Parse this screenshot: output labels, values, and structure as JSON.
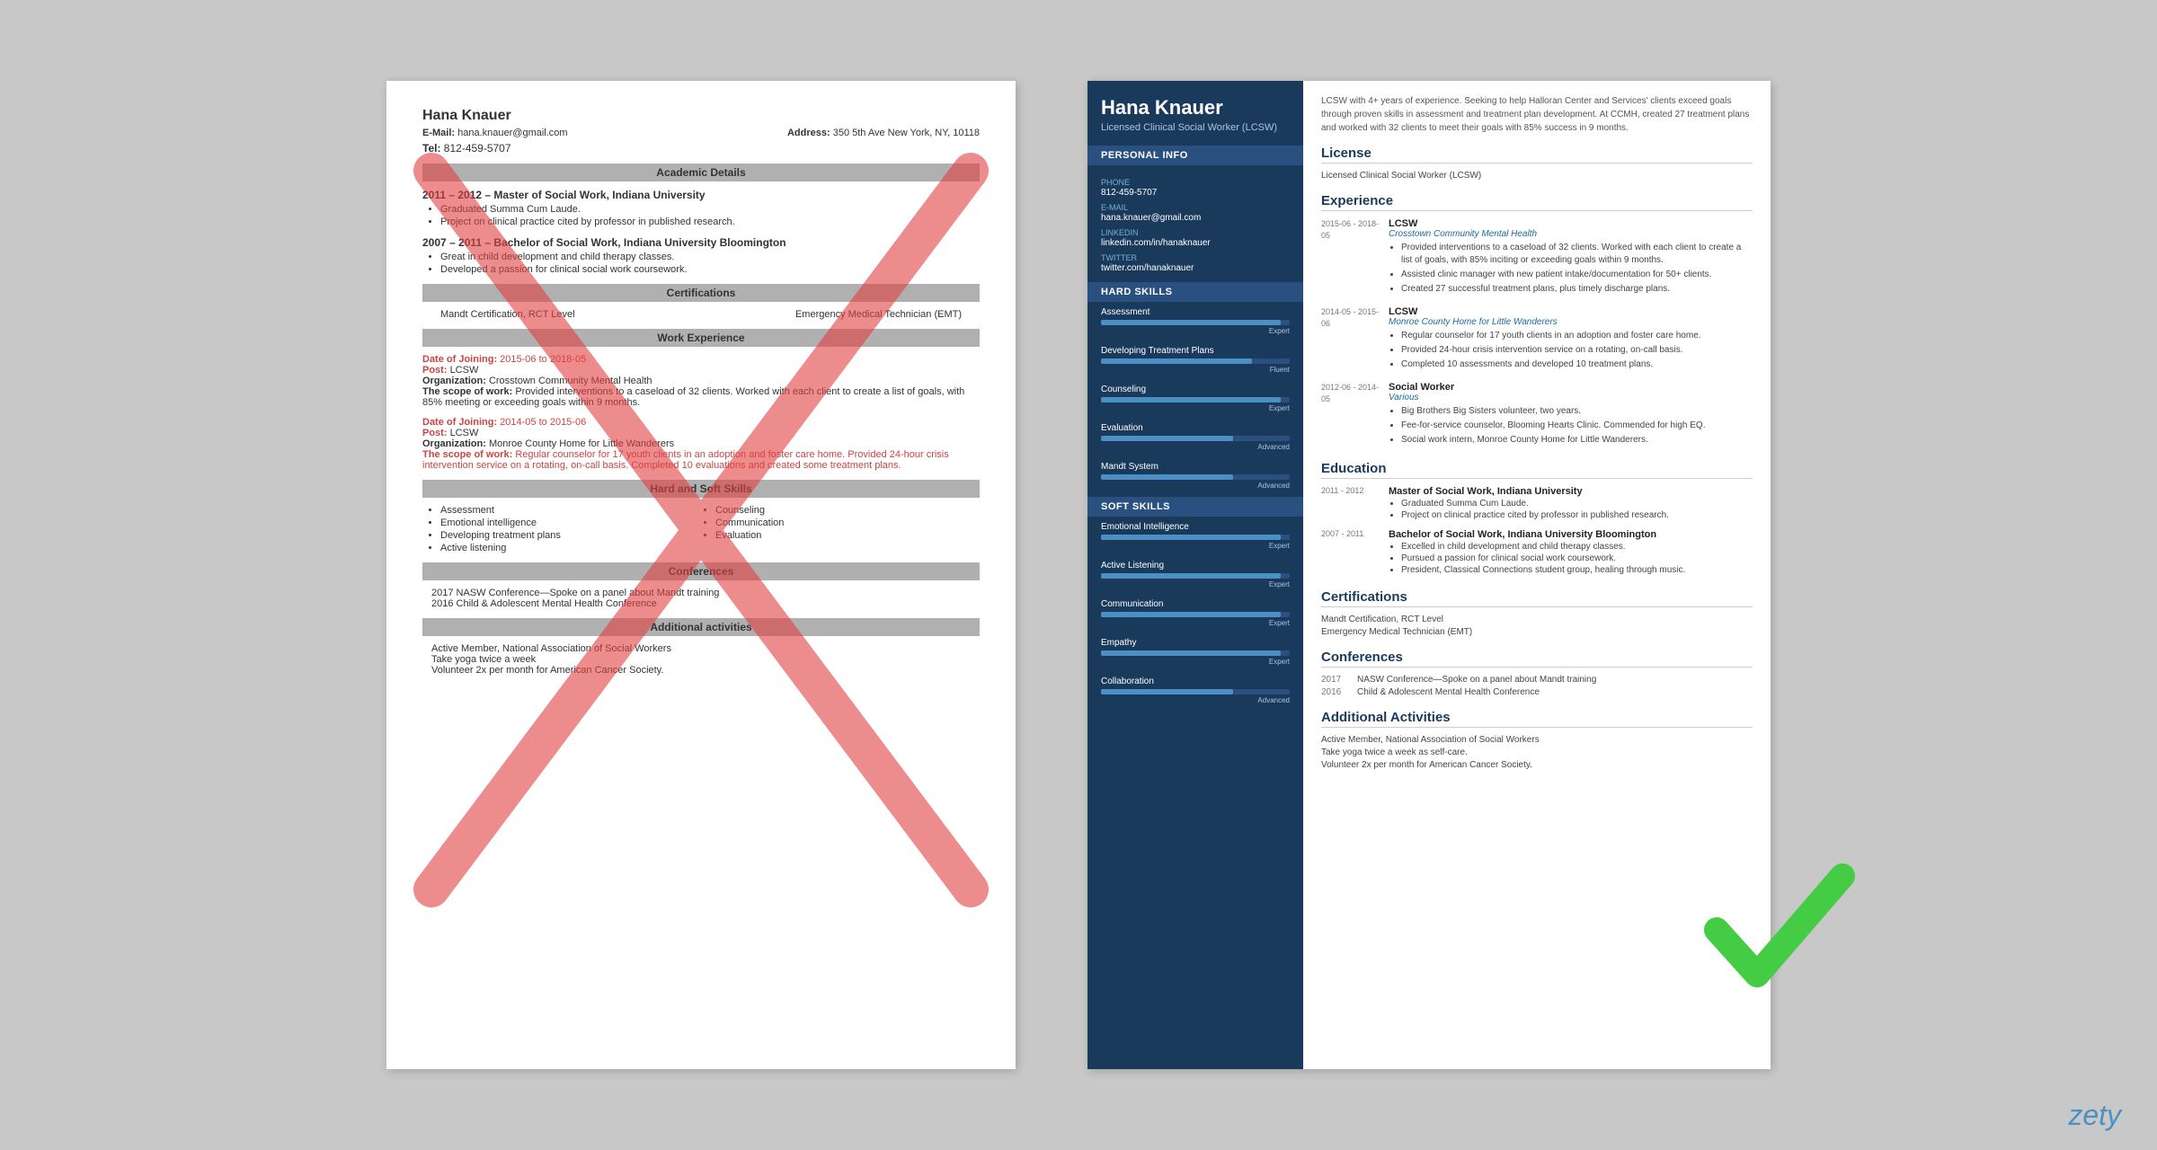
{
  "page": {
    "background": "#c8c8c8",
    "logo": "zety"
  },
  "bad_resume": {
    "name": "Hana Knauer",
    "email_label": "E-Mail:",
    "email": "hana.knauer@gmail.com",
    "address_label": "Address:",
    "address": "350 5th Ave New York, NY, 10118",
    "tel_label": "Tel:",
    "tel": "812-459-5707",
    "sections": {
      "academic": "Academic Details",
      "certs": "Certifications",
      "work": "Work Experience",
      "skills": "Hard and Soft Skills",
      "conferences": "Conferences",
      "activities": "Additional activities"
    },
    "edu": [
      {
        "years": "2011 – 2012 –",
        "degree": "Master of Social Work, Indiana University",
        "bullets": [
          "Graduated Summa Cum Laude.",
          "Project on clinical practice cited by professor in published research."
        ]
      },
      {
        "years": "2007 – 2011 –",
        "degree": "Bachelor of Social Work, Indiana University Bloomington",
        "bullets": [
          "Great in child development and child therapy classes.",
          "Developed a passion for clinical social work coursework."
        ]
      }
    ],
    "certs": [
      "Mandt Certification, RCT Level",
      "Emergency Medical Technician (EMT)"
    ],
    "work": [
      {
        "date_label": "Date of Joining:",
        "date": "2015-06 to 2018-05",
        "post_label": "Post:",
        "post": "LCSW",
        "org_label": "Organization:",
        "org": "Crosstown Community Mental Health",
        "scope_label": "The scope of work:",
        "scope": "Provided interventions to a caseload of 32 clients. Worked with each client to create a list of goals, with 85% meeting or exceeding goals within 9 months."
      },
      {
        "date_label": "Date of Joining:",
        "date": "2014-05 to 2015-06",
        "post_label": "Post:",
        "post": "LCSW",
        "org_label": "Organization:",
        "org": "Monroe County Home for Little Wanderers",
        "scope_label": "The scope of work:",
        "scope": "Regular counselor for 17 youth clients in an adoption and foster care home. Provided 24-hour crisis intervention service on a rotating, on-call basis. Completed 10 evaluations and created some treatment plans."
      }
    ],
    "skills": [
      "Assessment",
      "Emotional intelligence",
      "Developing treatment plans",
      "Active listening",
      "Counseling",
      "Communication",
      "Evaluation"
    ],
    "conferences": [
      "2017 NASW Conference—Spoke on a panel about Mandt training",
      "2016 Child & Adolescent Mental Health Conference"
    ],
    "activities": [
      "Active Member, National Association of Social Workers",
      "Take yoga twice a week",
      "Volunteer 2x per month for American Cancer Society."
    ]
  },
  "good_resume": {
    "name": "Hana Knauer",
    "title": "Licensed Clinical Social Worker (LCSW)",
    "summary": "LCSW with 4+ years of experience. Seeking to help Halloran Center and Services' clients exceed goals through proven skills in assessment and treatment plan development. At CCMH, created 27 treatment plans and worked with 32 clients to meet their goals with 85% success in 9 months.",
    "personal_info_title": "Personal Info",
    "phone_label": "Phone",
    "phone": "812-459-5707",
    "email_label": "E-mail",
    "email": "hana.knauer@gmail.com",
    "linkedin_label": "LinkedIn",
    "linkedin": "linkedin.com/in/hanaknauer",
    "twitter_label": "Twitter",
    "twitter": "twitter.com/hanaknauer",
    "hard_skills_title": "Hard Skills",
    "skills_hard": [
      {
        "name": "Assessment",
        "level": "Expert",
        "pct": 95
      },
      {
        "name": "Developing Treatment Plans",
        "level": "Fluent",
        "pct": 80
      },
      {
        "name": "Counseling",
        "level": "Expert",
        "pct": 95
      },
      {
        "name": "Evaluation",
        "level": "Advanced",
        "pct": 70
      },
      {
        "name": "Mandt System",
        "level": "Advanced",
        "pct": 70
      }
    ],
    "soft_skills_title": "Soft Skills",
    "skills_soft": [
      {
        "name": "Emotional Intelligence",
        "level": "Expert",
        "pct": 95
      },
      {
        "name": "Active Listening",
        "level": "Expert",
        "pct": 95
      },
      {
        "name": "Communication",
        "level": "Expert",
        "pct": 95
      },
      {
        "name": "Empathy",
        "level": "Expert",
        "pct": 95
      },
      {
        "name": "Collaboration",
        "level": "Advanced",
        "pct": 70
      }
    ],
    "license_title": "License",
    "license": "Licensed Clinical Social Worker (LCSW)",
    "experience_title": "Experience",
    "experience": [
      {
        "date": "2015-06 - 2018-05",
        "title": "LCSW",
        "employer": "Crosstown Community Mental Health",
        "bullets": [
          "Provided interventions to a caseload of 32 clients. Worked with each client to create a list of goals, with 85% inciting or exceeding goals within 9 months.",
          "Assisted clinic manager with new patient intake/documentation for 50+ clients.",
          "Created 27 successful treatment plans, plus timely discharge plans."
        ]
      },
      {
        "date": "2014-05 - 2015-06",
        "title": "LCSW",
        "employer": "Monroe County Home for Little Wanderers",
        "bullets": [
          "Regular counselor for 17 youth clients in an adoption and foster care home.",
          "Provided 24-hour crisis intervention service on a rotating, on-call basis.",
          "Completed 10 assessments and developed 10 treatment plans."
        ]
      },
      {
        "date": "2012-06 - 2014-05",
        "title": "Social Worker",
        "employer": "Various",
        "bullets": [
          "Big Brothers Big Sisters volunteer, two years.",
          "Fee-for-service counselor, Blooming Hearts Clinic. Commended for high EQ.",
          "Social work intern, Monroe County Home for Little Wanderers."
        ]
      }
    ],
    "education_title": "Education",
    "education": [
      {
        "years": "2011 - 2012",
        "degree": "Master of Social Work, Indiana University",
        "bullets": [
          "Graduated Summa Cum Laude.",
          "Project on clinical practice cited by professor in published research."
        ]
      },
      {
        "years": "2007 - 2011",
        "degree": "Bachelor of Social Work, Indiana University Bloomington",
        "bullets": [
          "Excelled in child development and child therapy classes.",
          "Pursued a passion for clinical social work coursework.",
          "President, Classical Connections student group, healing through music."
        ]
      }
    ],
    "certs_title": "Certifications",
    "certs": [
      "Mandt Certification, RCT Level",
      "Emergency Medical Technician (EMT)"
    ],
    "conferences_title": "Conferences",
    "conferences": [
      {
        "year": "2017",
        "title": "NASW Conference—Spoke on a panel about Mandt training"
      },
      {
        "year": "2016",
        "title": "Child & Adolescent Mental Health Conference"
      }
    ],
    "activities_title": "Additional Activities",
    "activities": [
      "Active Member, National Association of Social Workers",
      "Take yoga twice a week as self-care.",
      "Volunteer 2x per month for American Cancer Society."
    ]
  }
}
